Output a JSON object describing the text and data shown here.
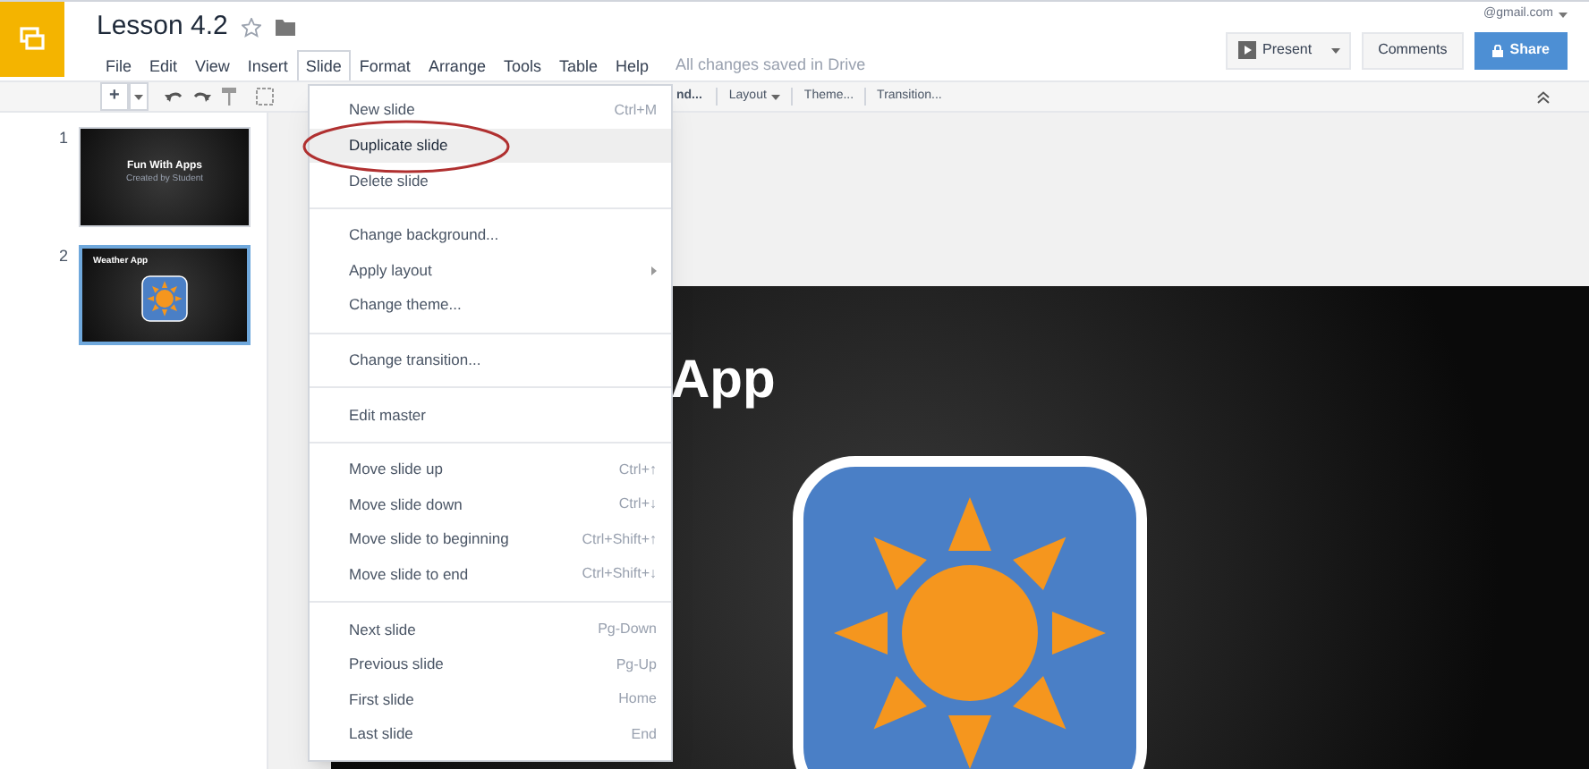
{
  "document": {
    "title": "Lesson 4.2",
    "starred": false
  },
  "menu_bar": [
    {
      "label": "File",
      "selected": false
    },
    {
      "label": "Edit",
      "selected": false
    },
    {
      "label": "View",
      "selected": false
    },
    {
      "label": "Insert",
      "selected": false
    },
    {
      "label": "Slide",
      "selected": true
    },
    {
      "label": "Format",
      "selected": false
    },
    {
      "label": "Arrange",
      "selected": false
    },
    {
      "label": "Tools",
      "selected": false
    },
    {
      "label": "Table",
      "selected": false
    },
    {
      "label": "Help",
      "selected": false
    }
  ],
  "save_status": "All changes saved in Drive",
  "account": "@gmail.com",
  "header_buttons": [
    {
      "label": "Present",
      "kind": "present"
    },
    {
      "label": "Comments",
      "kind": "plain"
    },
    {
      "label": "Share",
      "kind": "share"
    }
  ],
  "toolbar": {
    "new_symbol": "+",
    "partial_button": "nd...",
    "buttons": [
      "Layout",
      "Theme...",
      "Transition..."
    ]
  },
  "slides": [
    {
      "number": "1",
      "title": "Fun With Apps",
      "subtitle": "Created by Student",
      "kind": "title",
      "selected": false
    },
    {
      "number": "2",
      "title": "Weather App",
      "kind": "icon",
      "selected": true
    }
  ],
  "slide_canvas": {
    "title_visible": "App"
  },
  "slide_menu": [
    [
      {
        "label": "New slide",
        "shortcut": "Ctrl+M",
        "highlighted": false,
        "circled": false,
        "submenu": false
      },
      {
        "label": "Duplicate slide",
        "highlighted": true,
        "circled": true,
        "submenu": false
      },
      {
        "label": "Delete slide",
        "highlighted": false,
        "circled": false,
        "submenu": false
      }
    ],
    [
      {
        "label": "Change background...",
        "highlighted": false,
        "circled": false,
        "submenu": false
      },
      {
        "label": "Apply layout",
        "highlighted": false,
        "circled": false,
        "submenu": true
      },
      {
        "label": "Change theme...",
        "highlighted": false,
        "circled": false,
        "submenu": false
      }
    ],
    [
      {
        "label": "Change transition...",
        "highlighted": false,
        "circled": false,
        "submenu": false
      }
    ],
    [
      {
        "label": "Edit master",
        "highlighted": false,
        "circled": false,
        "submenu": false
      }
    ],
    [
      {
        "label": "Move slide up",
        "shortcut": "Ctrl+↑",
        "highlighted": false,
        "circled": false,
        "submenu": false
      },
      {
        "label": "Move slide down",
        "shortcut": "Ctrl+↓",
        "highlighted": false,
        "circled": false,
        "submenu": false
      },
      {
        "label": "Move slide to beginning",
        "shortcut": "Ctrl+Shift+↑",
        "highlighted": false,
        "circled": false,
        "submenu": false
      },
      {
        "label": "Move slide to end",
        "shortcut": "Ctrl+Shift+↓",
        "highlighted": false,
        "circled": false,
        "submenu": false
      }
    ],
    [
      {
        "label": "Next slide",
        "shortcut": "Pg-Down",
        "highlighted": false,
        "circled": false,
        "submenu": false
      },
      {
        "label": "Previous slide",
        "shortcut": "Pg-Up",
        "highlighted": false,
        "circled": false,
        "submenu": false
      },
      {
        "label": "First slide",
        "shortcut": "Home",
        "highlighted": false,
        "circled": false,
        "submenu": false
      },
      {
        "label": "Last slide",
        "shortcut": "End",
        "highlighted": false,
        "circled": false,
        "submenu": false
      }
    ]
  ]
}
